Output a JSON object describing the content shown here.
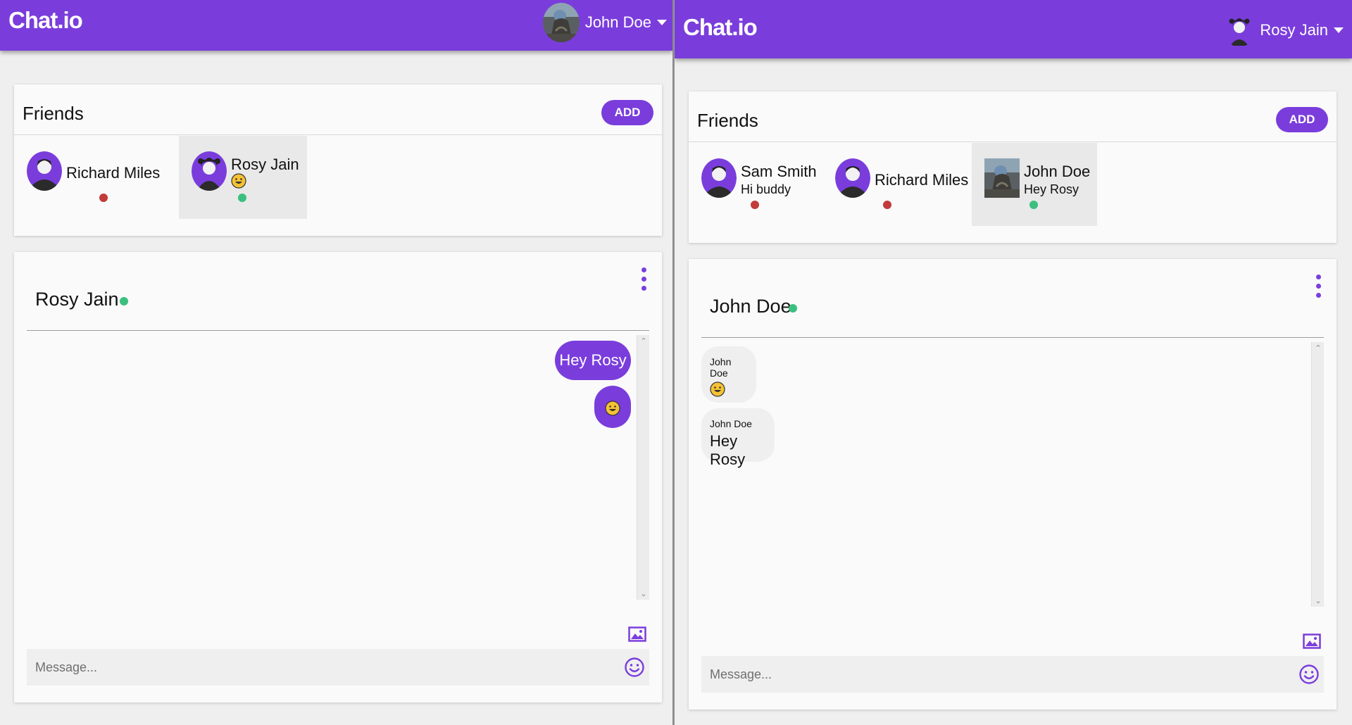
{
  "colors": {
    "accent": "#7a3ddc",
    "online": "#3bbf7f",
    "offline": "#c23a3a"
  },
  "left": {
    "app": {
      "brand": "Chat.io",
      "current_user": "John Doe",
      "avatar_icon": "photo-avatar-icon"
    },
    "friends": {
      "title": "Friends",
      "add_label": "ADD",
      "items": [
        {
          "name": "Richard Miles",
          "status": "offline",
          "avatar_icon": "male-avatar-icon",
          "selected": false
        },
        {
          "name": "Rosy Jain",
          "subtitle_emoji": "grinning-face-emoji",
          "status": "online",
          "avatar_icon": "female-avatar-icon",
          "selected": true
        }
      ]
    },
    "chat": {
      "name": "Rosy Jain",
      "status": "online",
      "messages": [
        {
          "direction": "outgoing",
          "text": "Hey Rosy"
        },
        {
          "direction": "outgoing",
          "emoji": "grinning-face-emoji"
        }
      ],
      "input_placeholder": "Message..."
    }
  },
  "right": {
    "app": {
      "brand": "Chat.io",
      "current_user": "Rosy Jain",
      "avatar_icon": "female-avatar-icon"
    },
    "friends": {
      "title": "Friends",
      "add_label": "ADD",
      "items": [
        {
          "name": "Sam Smith",
          "subtitle": "Hi buddy",
          "status": "offline",
          "avatar_icon": "male-avatar-icon",
          "selected": false
        },
        {
          "name": "Richard Miles",
          "status": "offline",
          "avatar_icon": "male-avatar-icon",
          "selected": false
        },
        {
          "name": "John Doe",
          "subtitle": "Hey Rosy",
          "status": "online",
          "avatar_icon": "photo-avatar-icon",
          "selected": true
        }
      ]
    },
    "chat": {
      "name": "John Doe",
      "status": "online",
      "messages": [
        {
          "direction": "incoming",
          "sender": "John Doe",
          "emoji": "grinning-face-emoji"
        },
        {
          "direction": "incoming",
          "sender": "John Doe",
          "text": "Hey Rosy"
        }
      ],
      "input_placeholder": "Message..."
    }
  }
}
